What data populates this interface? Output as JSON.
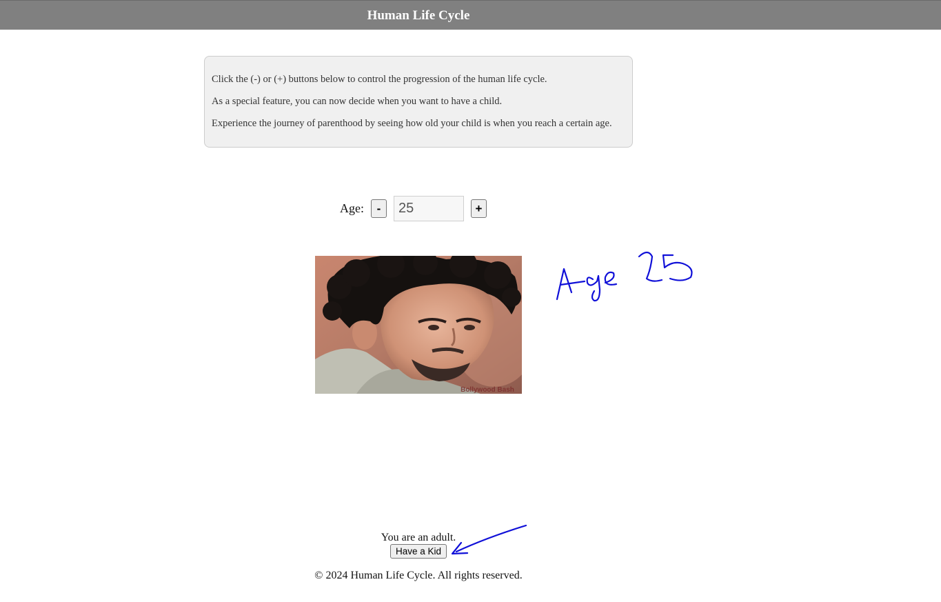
{
  "header": {
    "title": "Human Life Cycle"
  },
  "info": {
    "lines": [
      "Click the (-) or (+) buttons below to control the progression of the human life cycle.",
      "As a special feature, you can now decide when you want to have a child.",
      "Experience the journey of parenthood by seeing how old your child is when you reach a certain age."
    ]
  },
  "age_control": {
    "label": "Age:",
    "decrement_label": "-",
    "increment_label": "+",
    "value": "25"
  },
  "photo": {
    "watermark": "Bollywood Bash"
  },
  "annotation": {
    "text": "Age 25",
    "color": "#1010d8"
  },
  "status": {
    "message": "You are an adult.",
    "kid_button_label": "Have a Kid"
  },
  "footer": {
    "text": "© 2024 Human Life Cycle. All rights reserved."
  }
}
